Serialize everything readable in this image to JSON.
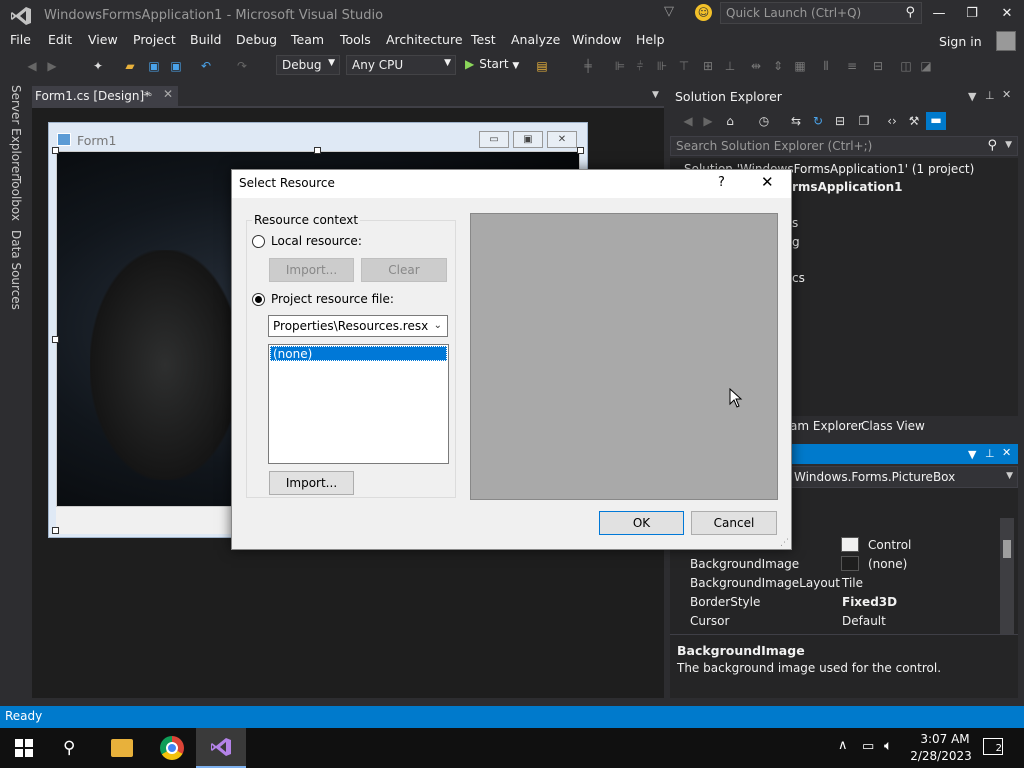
{
  "window": {
    "title": "WindowsFormsApplication1 - Microsoft Visual Studio",
    "quick_launch_placeholder": "Quick Launch (Ctrl+Q)",
    "sign_in": "Sign in"
  },
  "menu": [
    "File",
    "Edit",
    "View",
    "Project",
    "Build",
    "Debug",
    "Team",
    "Tools",
    "Architecture",
    "Test",
    "Analyze",
    "Window",
    "Help"
  ],
  "toolbar": {
    "config": "Debug",
    "platform": "Any CPU",
    "start": "Start"
  },
  "side_tabs": [
    "Server Explorer",
    "Toolbox",
    "Data Sources"
  ],
  "document": {
    "tab_label": "Form1.cs [Design]*",
    "form_title": "Form1"
  },
  "solution_explorer": {
    "title": "Solution Explorer",
    "search_placeholder": "Search Solution Explorer (Ctrl+;)",
    "solution_line": "Solution 'WindowsFormsApplication1' (1 project)",
    "project_line": "rmsApplication1",
    "partial_items": [
      "s",
      "g",
      "cs"
    ],
    "tabs": [
      "am Explorer",
      "Class View"
    ]
  },
  "properties": {
    "object": "Windows.Forms.PictureBox",
    "rows": [
      {
        "name": "",
        "value": "Control",
        "swatch": "#f0f0f0"
      },
      {
        "name": "BackgroundImage",
        "value": "(none)",
        "swatch": "#1e1e1e"
      },
      {
        "name": "BackgroundImageLayout",
        "value": "Tile"
      },
      {
        "name": "BorderStyle",
        "value": "Fixed3D",
        "bold": true
      },
      {
        "name": "Cursor",
        "value": "Default"
      }
    ],
    "desc_title": "BackgroundImage",
    "desc_text": "The background image used for the control."
  },
  "status": "Ready",
  "dialog": {
    "title": "Select Resource",
    "help": "?",
    "resource_context": "Resource context",
    "local_resource": "Local resource:",
    "local_import": "Import...",
    "local_clear": "Clear",
    "project_resource_file": "Project resource file:",
    "resource_file": "Properties\\Resources.resx",
    "list_items": [
      "(none)"
    ],
    "project_import": "Import...",
    "ok": "OK",
    "cancel": "Cancel",
    "selected_radio": "project"
  },
  "taskbar": {
    "time": "3:07 AM",
    "date": "2/28/2023",
    "notifications": "2"
  },
  "colors": {
    "accent": "#007acc",
    "selection": "#0078d7",
    "chrome_bg": "#2d2d30"
  }
}
